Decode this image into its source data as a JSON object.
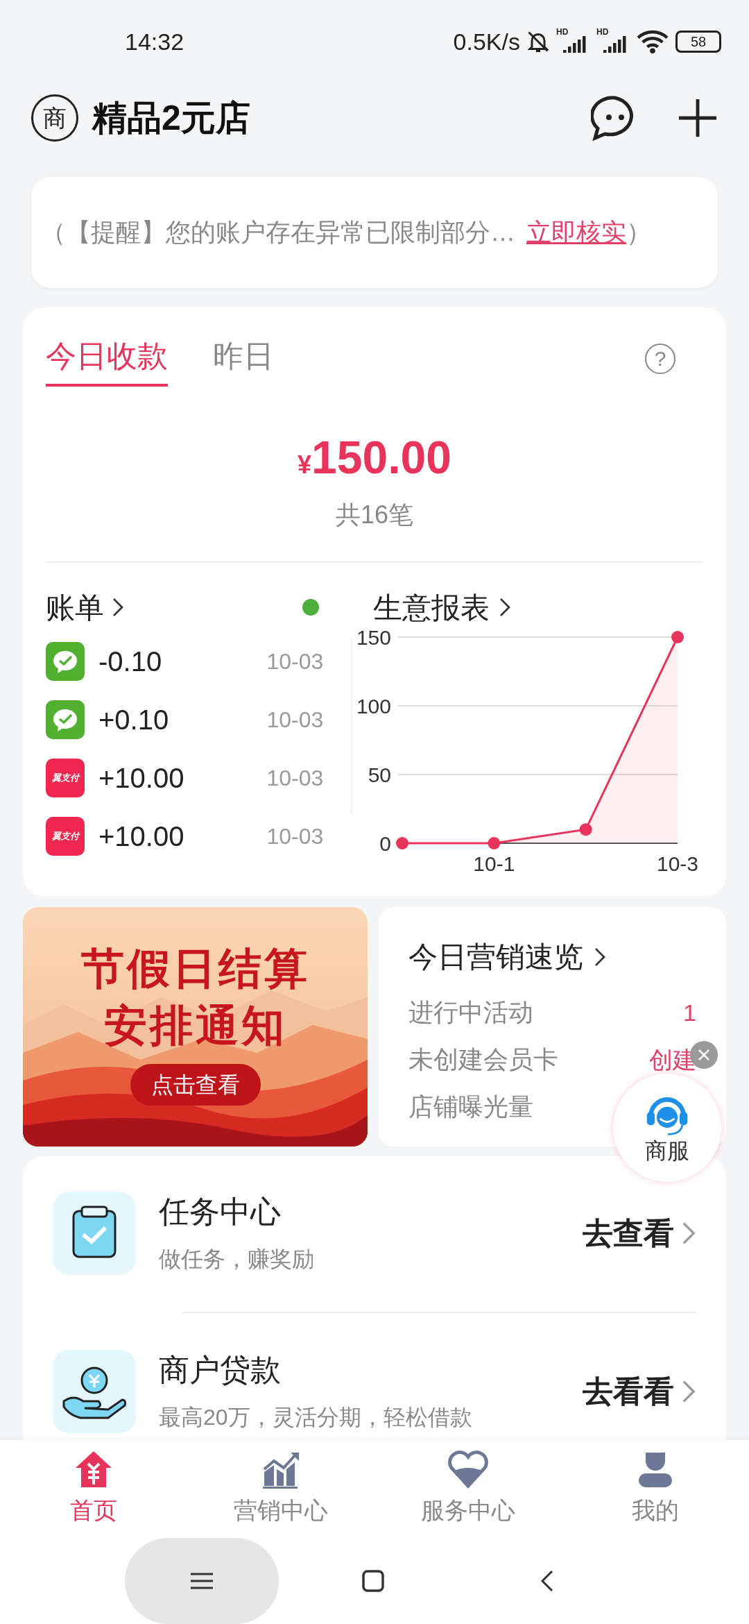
{
  "status_bar": {
    "time": "14:32",
    "net_speed": "0.5K/s",
    "signals": [
      "HD",
      "HD"
    ],
    "battery": "58"
  },
  "header": {
    "logo": "商",
    "title": "精品2元店"
  },
  "notice": {
    "text": "（【提醒】您的账户存在异常已限制部分…",
    "link": "立即核实",
    "close_paren": "）"
  },
  "tabs": [
    {
      "label": "今日收款",
      "selected": true
    },
    {
      "label": "昨日",
      "selected": false
    }
  ],
  "help": "?",
  "summary": {
    "currency": "¥",
    "amount": "150.00",
    "count": "共16笔"
  },
  "bills": {
    "title": "账单",
    "status_dot": {
      "color": "#4caf3a"
    },
    "items": [
      {
        "kind": "wechat",
        "amount": "-0.10",
        "date": "10-03"
      },
      {
        "kind": "wechat",
        "amount": "+0.10",
        "date": "10-03"
      },
      {
        "kind": "bestpay",
        "label": "翼支付",
        "amount": "+10.00",
        "date": "10-03"
      },
      {
        "kind": "bestpay",
        "label": "翼支付",
        "amount": "+10.00",
        "date": "10-03"
      }
    ]
  },
  "report": {
    "title": "生意报表",
    "chart_data": {
      "type": "area",
      "categories": [
        null,
        "10-1",
        null,
        "10-3"
      ],
      "series": [
        {
          "color": "#e8335a",
          "values": [
            0,
            0,
            10,
            150
          ]
        }
      ],
      "yticks": [
        0,
        50,
        100,
        150
      ],
      "ylim": [
        0,
        150
      ]
    }
  },
  "banner": {
    "kind": "picture",
    "headline": [
      "节假日结算",
      "安排通知"
    ],
    "button": "点击查看"
  },
  "marketing": {
    "title": "今日营销速览",
    "rows": [
      {
        "label": "进行中活动",
        "value": "1"
      },
      {
        "label": "未创建会员卡",
        "value": "创建"
      },
      {
        "label": "店铺曝光量"
      }
    ]
  },
  "float_button": {
    "label": "商服"
  },
  "tasks": [
    {
      "kind": "task",
      "title": "任务中心",
      "subtitle": "做任务，赚奖励",
      "action": "去查看"
    },
    {
      "kind": "loan",
      "title": "商户贷款",
      "subtitle": "最高20万，灵活分期，轻松借款",
      "action": "去看看"
    }
  ],
  "bottom_nav": [
    {
      "kind": "home",
      "label": "首页",
      "selected": true
    },
    {
      "kind": "marketing",
      "label": "营销中心",
      "selected": false
    },
    {
      "kind": "service",
      "label": "服务中心",
      "selected": false
    },
    {
      "kind": "me",
      "label": "我的",
      "selected": false
    }
  ]
}
